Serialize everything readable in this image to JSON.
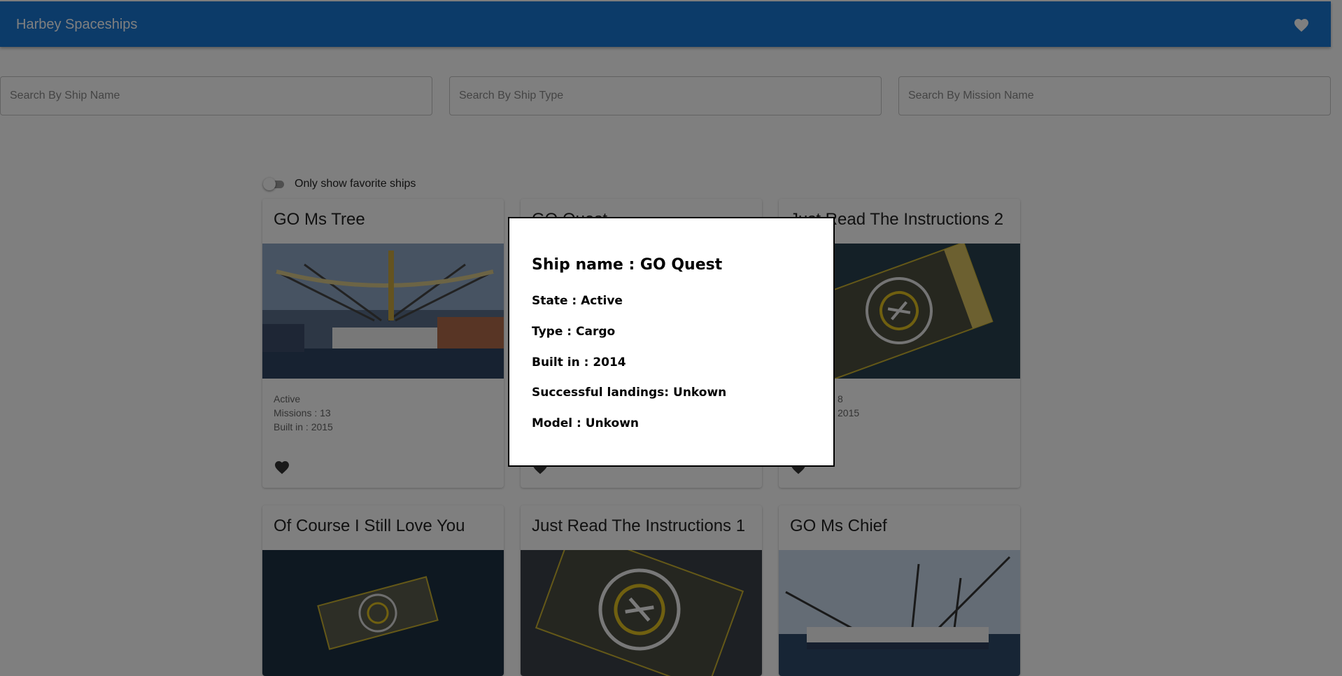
{
  "app": {
    "title": "Harbey Spaceships"
  },
  "search": {
    "ship_name_placeholder": "Search By Ship Name",
    "ship_type_placeholder": "Search By Ship Type",
    "mission_name_placeholder": "Search By Mission Name"
  },
  "filter": {
    "favorites_label": "Only show favorite ships",
    "favorites_on": false
  },
  "cards": [
    {
      "name": "GO Ms Tree",
      "status": "Active",
      "missions": "Missions : 13",
      "built": "Built in : 2015"
    },
    {
      "name": "GO Quest",
      "status": "",
      "missions": "",
      "built": ""
    },
    {
      "name": "Just Read The Instructions 2",
      "status": "",
      "missions": "8",
      "built": "2015"
    },
    {
      "name": "Of Course I Still Love You"
    },
    {
      "name": "Just Read The Instructions 1"
    },
    {
      "name": "GO Ms Chief"
    }
  ],
  "modal": {
    "ship_name": "Ship name : GO Quest",
    "state": "State : Active",
    "type": "Type : Cargo",
    "built": "Built in : 2014",
    "landings": "Successful landings: Unkown",
    "model": "Model : Unkown"
  },
  "colors": {
    "appbar": "#1976d2",
    "overlay": "rgba(0,0,0,0.5)"
  }
}
